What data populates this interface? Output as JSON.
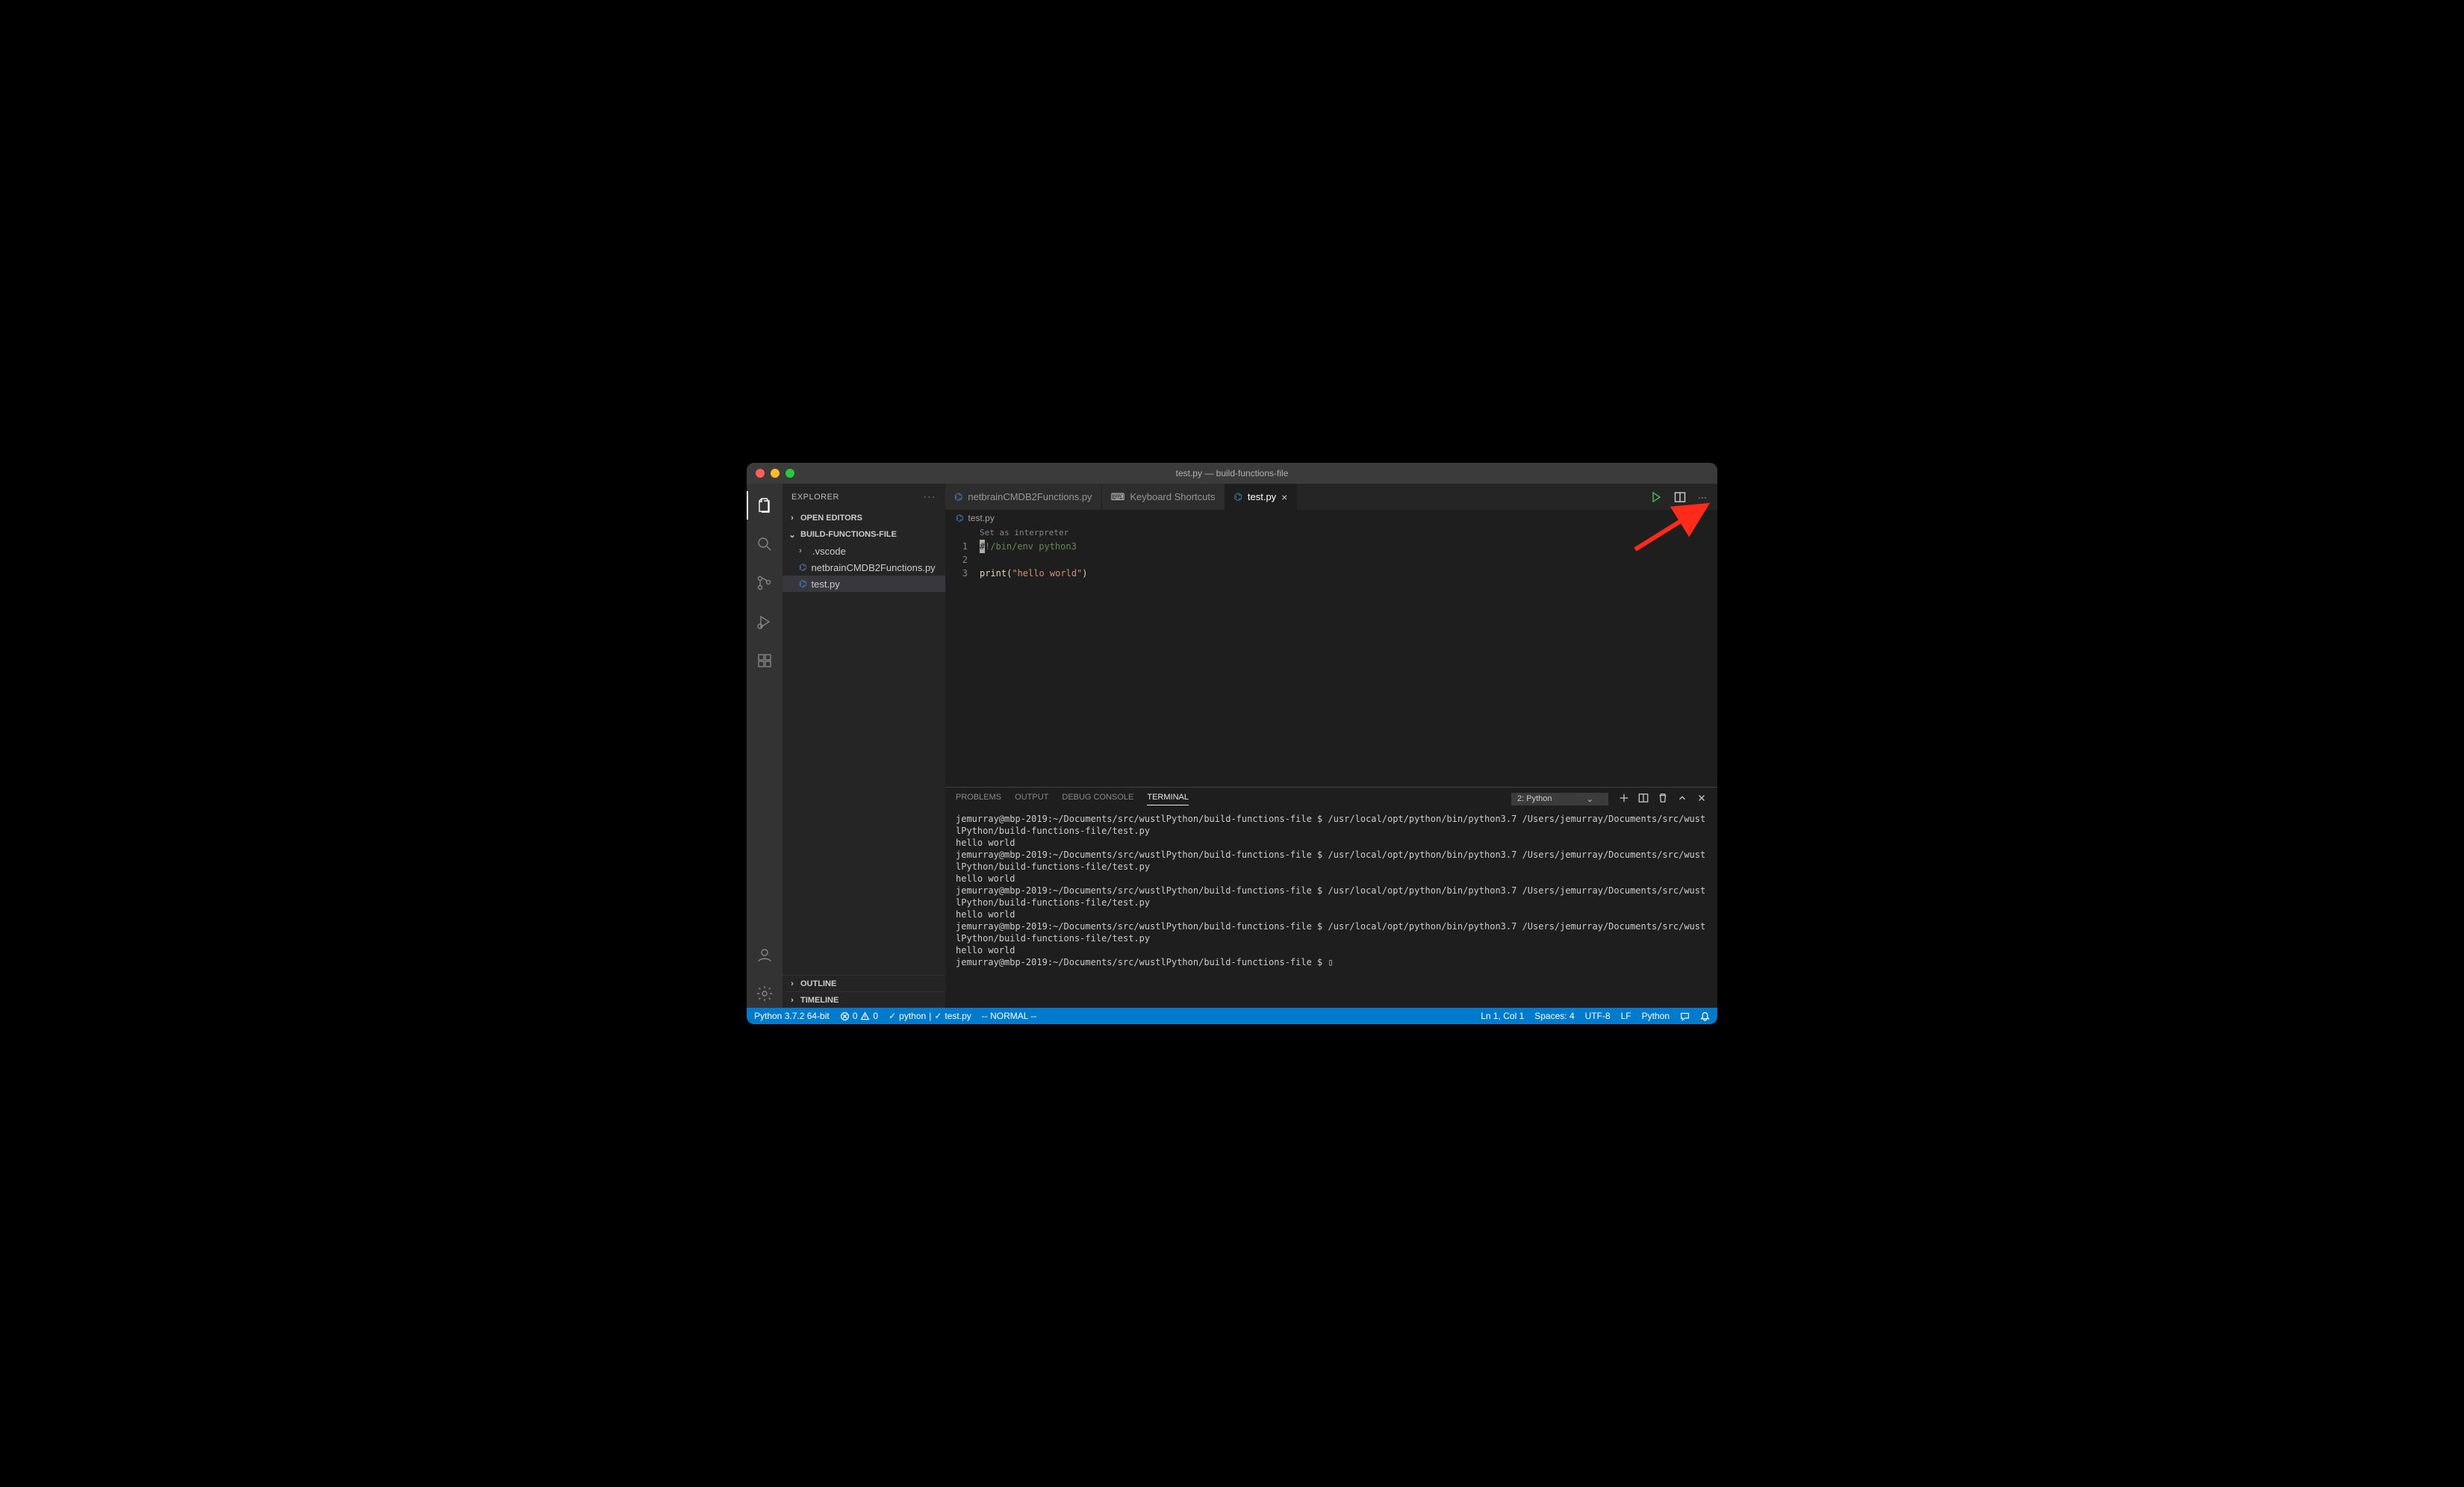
{
  "window": {
    "title": "test.py — build-functions-file"
  },
  "sidebar": {
    "title": "EXPLORER",
    "sections": {
      "open_editors": "OPEN EDITORS",
      "workspace": "BUILD-FUNCTIONS-FILE",
      "outline": "OUTLINE",
      "timeline": "TIMELINE"
    },
    "tree": {
      "folder": ".vscode",
      "file1": "netbrainCMDB2Functions.py",
      "file2": "test.py"
    }
  },
  "tabs": {
    "t1": "netbrainCMDB2Functions.py",
    "t2": "Keyboard Shortcuts",
    "t3": "test.py"
  },
  "breadcrumb": {
    "file": "test.py"
  },
  "editor": {
    "codelens": "Set as interpreter",
    "line1_rest": "!/bin/env python3",
    "line3_fn": "print",
    "line3_paren_open": "(",
    "line3_str": "\"hello world\"",
    "line3_paren_close": ")",
    "ln1": "1",
    "ln2": "2",
    "ln3": "3"
  },
  "panel": {
    "tabs": {
      "problems": "PROBLEMS",
      "output": "OUTPUT",
      "debug": "DEBUG CONSOLE",
      "terminal": "TERMINAL"
    },
    "select": "2: Python"
  },
  "terminal": {
    "lines": [
      "jemurray@mbp-2019:~/Documents/src/wustlPython/build-functions-file $ /usr/local/opt/python/bin/python3.7 /Users/jemurray/Documents/src/wustlPython/build-functions-file/test.py",
      "hello world",
      "jemurray@mbp-2019:~/Documents/src/wustlPython/build-functions-file $ /usr/local/opt/python/bin/python3.7 /Users/jemurray/Documents/src/wustlPython/build-functions-file/test.py",
      "hello world",
      "jemurray@mbp-2019:~/Documents/src/wustlPython/build-functions-file $ /usr/local/opt/python/bin/python3.7 /Users/jemurray/Documents/src/wustlPython/build-functions-file/test.py",
      "hello world",
      "jemurray@mbp-2019:~/Documents/src/wustlPython/build-functions-file $ /usr/local/opt/python/bin/python3.7 /Users/jemurray/Documents/src/wustlPython/build-functions-file/test.py",
      "hello world",
      "jemurray@mbp-2019:~/Documents/src/wustlPython/build-functions-file $ ▯"
    ]
  },
  "status": {
    "python": "Python 3.7.2 64-bit",
    "errors": "0",
    "warnings": "0",
    "item1": "python",
    "item2": "test.py",
    "mode": "-- NORMAL --",
    "lncol": "Ln 1, Col 1",
    "spaces": "Spaces: 4",
    "encoding": "UTF-8",
    "eol": "LF",
    "lang": "Python"
  }
}
